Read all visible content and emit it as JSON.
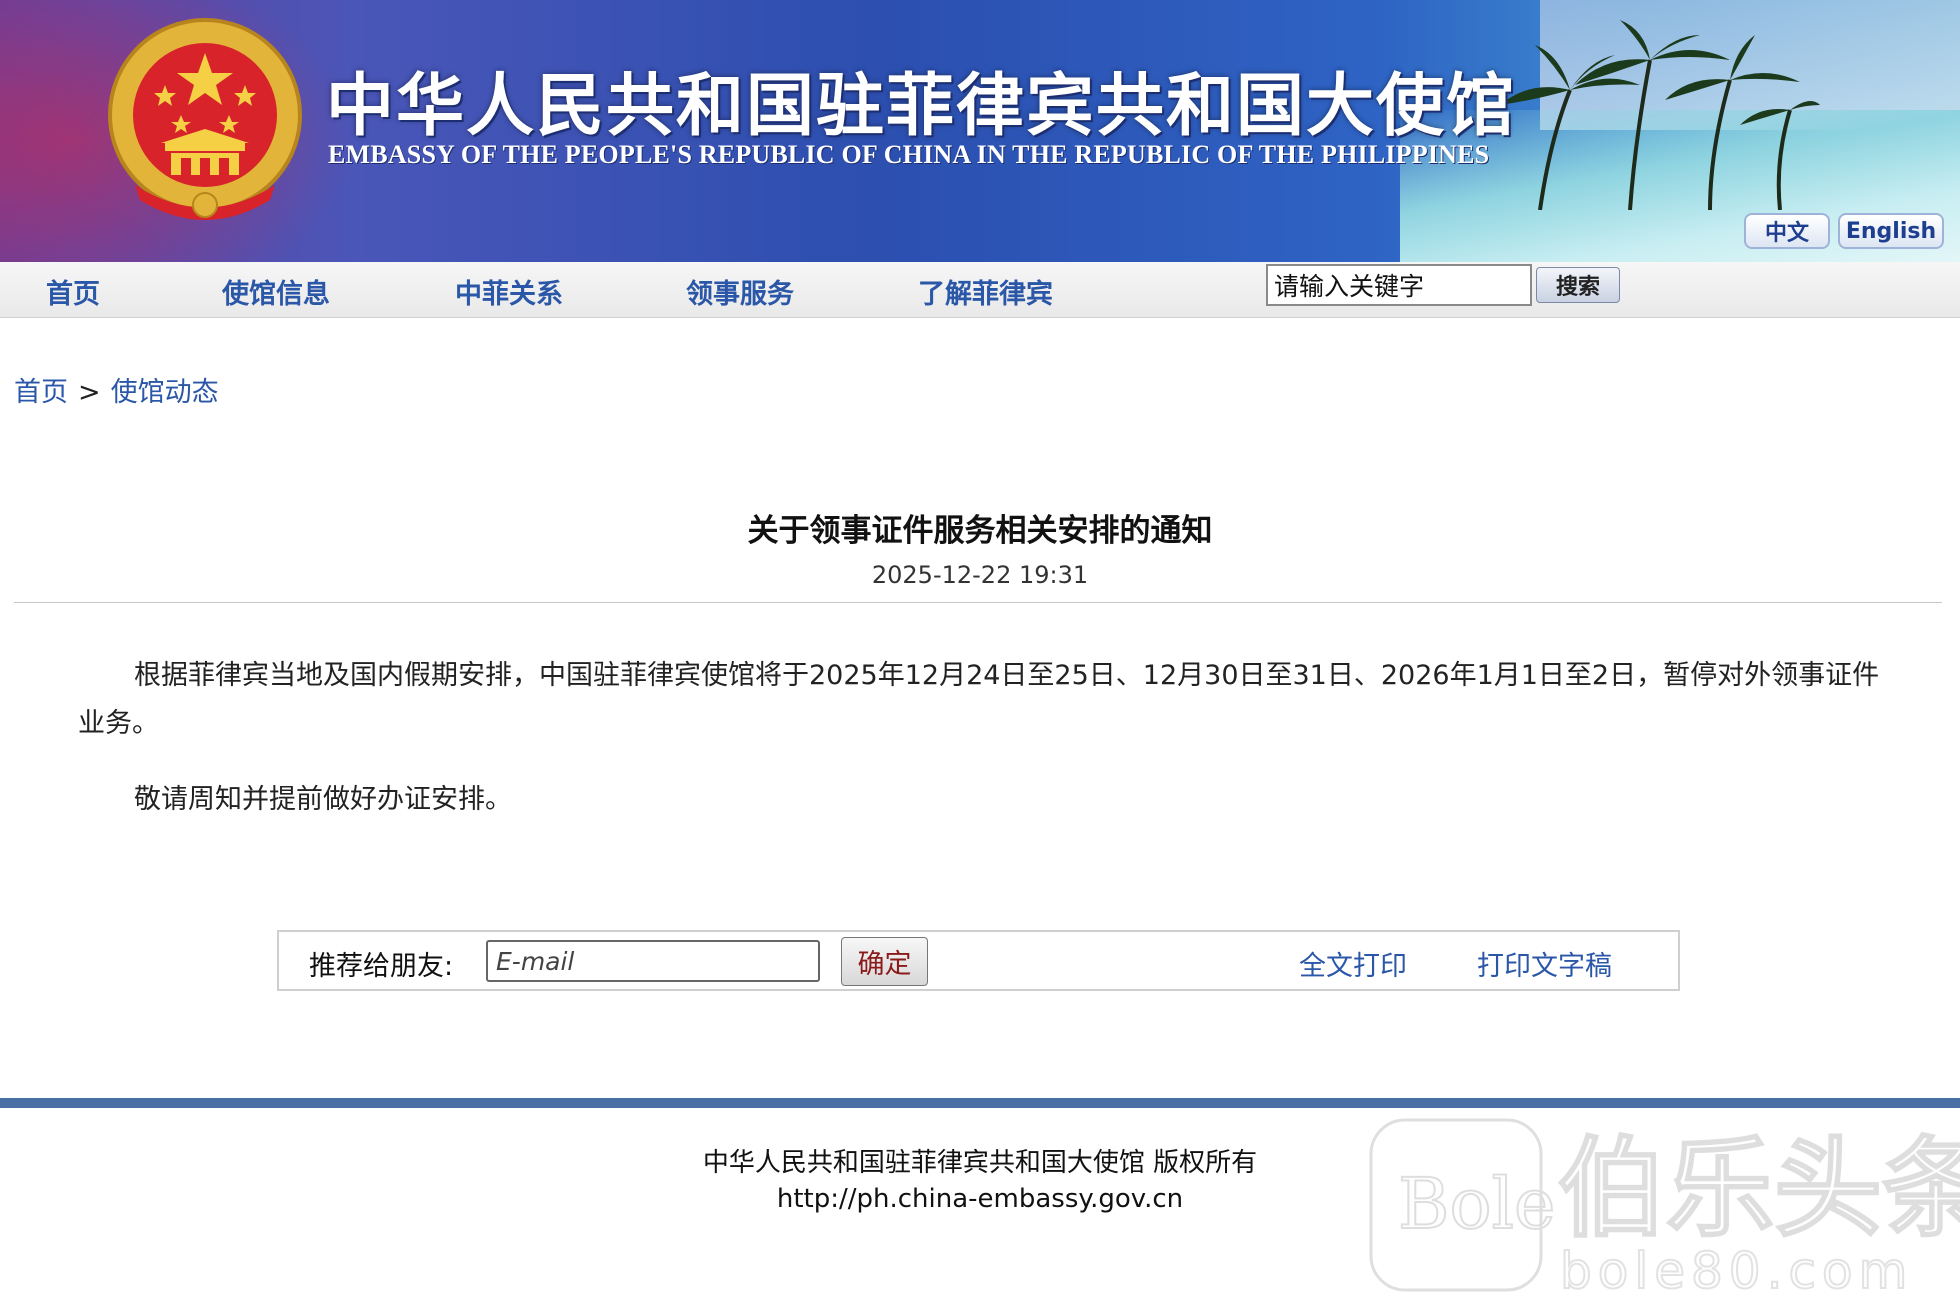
{
  "banner": {
    "title_zh": "中华人民共和国驻菲律宾共和国大使馆",
    "title_en": "EMBASSY OF THE PEOPLE'S REPUBLIC OF CHINA IN THE REPUBLIC OF THE PHILIPPINES",
    "lang_zh": "中文",
    "lang_en": "English"
  },
  "nav": {
    "items": [
      "首页",
      "使馆信息",
      "中菲关系",
      "领事服务",
      "了解菲律宾"
    ],
    "search_value": "请输入关键字",
    "search_button": "搜索"
  },
  "breadcrumb": {
    "home": "首页",
    "separator": ">",
    "current": "使馆动态"
  },
  "article": {
    "title": "关于领事证件服务相关安排的通知",
    "date": "2025-12-22 19:31",
    "paragraphs": [
      "根据菲律宾当地及国内假期安排，中国驻菲律宾使馆将于2025年12月24日至25日、12月30日至31日、2026年1月1日至2日，暂停对外领事证件业务。",
      "敬请周知并提前做好办证安排。"
    ]
  },
  "share": {
    "label": "推荐给朋友:",
    "email_placeholder": "E-mail",
    "confirm": "确定",
    "print_full": "全文打印",
    "print_text": "打印文字稿"
  },
  "footer": {
    "copyright": "中华人民共和国驻菲律宾共和国大使馆 版权所有",
    "url": "http://ph.china-embassy.gov.cn"
  },
  "watermark": {
    "logo_text": "Bole",
    "name": "伯乐头条",
    "domain": "bole80.com"
  },
  "colors": {
    "link": "#2b57a8",
    "footer_bar": "#4a6fa5",
    "confirm_text": "#8b1b1b"
  }
}
